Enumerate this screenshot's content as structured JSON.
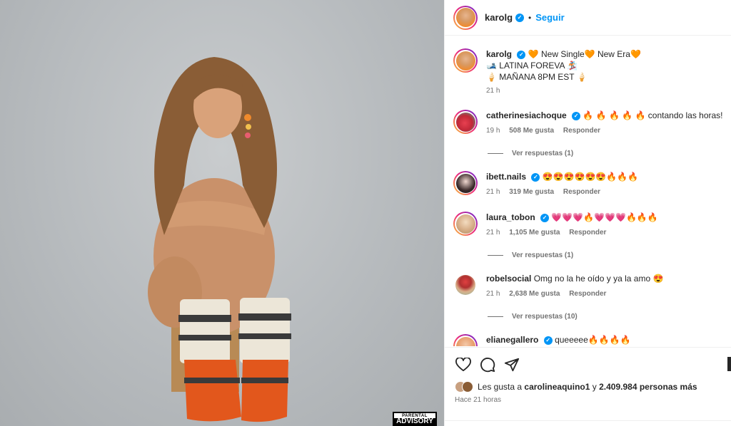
{
  "media": {
    "advisory_top": "PARENTAL",
    "advisory_bottom": "ADVISORY"
  },
  "header": {
    "username": "karolg",
    "separator": "•",
    "follow_label": "Seguir"
  },
  "caption": {
    "username": "karolg",
    "line1": "🧡 New Single🧡 New Era🧡",
    "line2": "🎿 LATINA FOREVA 🏂",
    "line3": "🍦 MAÑANA 8PM EST 🍦",
    "time": "21 h"
  },
  "comments": [
    {
      "username": "catherinesiachoque",
      "verified": true,
      "text": "🔥 🔥 🔥 🔥 🔥  contando las horas!",
      "time": "19 h",
      "likes": "508 Me gusta",
      "reply_label": "Responder",
      "view_replies": "Ver respuestas (1)"
    },
    {
      "username": "ibett.nails",
      "verified": true,
      "text": "😍😍😍😍😍😍🔥🔥🔥",
      "time": "21 h",
      "likes": "319 Me gusta",
      "reply_label": "Responder"
    },
    {
      "username": "laura_tobon",
      "verified": true,
      "text": "💗💗💗🔥💗💗💗🔥🔥🔥",
      "time": "21 h",
      "likes": "1,105 Me gusta",
      "reply_label": "Responder",
      "view_replies": "Ver respuestas (1)"
    },
    {
      "username": "robelsocial",
      "verified": false,
      "text": "Omg no la he oído y ya la amo 😍",
      "time": "21 h",
      "likes": "2,638 Me gusta",
      "reply_label": "Responder",
      "view_replies": "Ver respuestas (10)"
    },
    {
      "username": "elianegallero",
      "verified": true,
      "text": "queeeee🔥🔥🔥🔥"
    }
  ],
  "actions": {
    "likes_prefix": "Les gusta a",
    "liker": "carolineaquino1",
    "likes_mid": "y",
    "likes_rest": "2.409.984 personas más",
    "posted": "Hace 21 horas"
  },
  "colors": {
    "accent": "#0095f6",
    "muted": "#737373",
    "text": "#262626"
  }
}
